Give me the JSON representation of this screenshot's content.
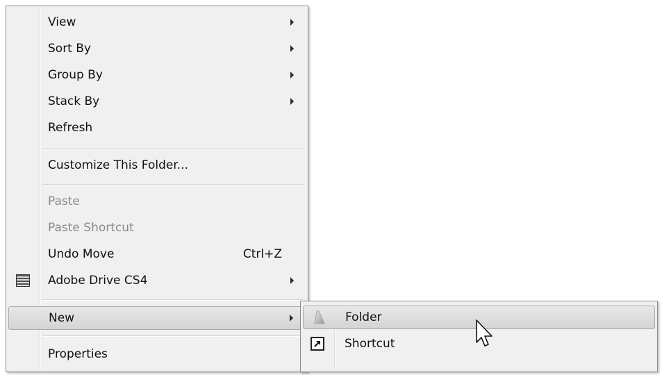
{
  "context_menu": {
    "items": [
      {
        "label": "View",
        "submenu": true,
        "enabled": true
      },
      {
        "label": "Sort By",
        "submenu": true,
        "enabled": true
      },
      {
        "label": "Group By",
        "submenu": true,
        "enabled": true
      },
      {
        "label": "Stack By",
        "submenu": true,
        "enabled": true
      },
      {
        "label": "Refresh",
        "submenu": false,
        "enabled": true
      },
      {
        "label": "Customize This Folder...",
        "submenu": false,
        "enabled": true
      },
      {
        "label": "Paste",
        "submenu": false,
        "enabled": false
      },
      {
        "label": "Paste Shortcut",
        "submenu": false,
        "enabled": false
      },
      {
        "label": "Undo Move",
        "shortcut": "Ctrl+Z",
        "submenu": false,
        "enabled": true
      },
      {
        "label": "Adobe Drive CS4",
        "submenu": true,
        "enabled": true,
        "icon": "adobe-drive-icon"
      },
      {
        "label": "New",
        "submenu": true,
        "enabled": true,
        "highlighted": true
      },
      {
        "label": "Properties",
        "submenu": false,
        "enabled": true
      }
    ]
  },
  "new_submenu": {
    "items": [
      {
        "label": "Folder",
        "icon": "folder-icon",
        "highlighted": true
      },
      {
        "label": "Shortcut",
        "icon": "shortcut-icon"
      }
    ]
  },
  "colors": {
    "menu_background": "#f0f0f0",
    "disabled_text": "#8a8a8a",
    "border": "#8c8c8c"
  }
}
